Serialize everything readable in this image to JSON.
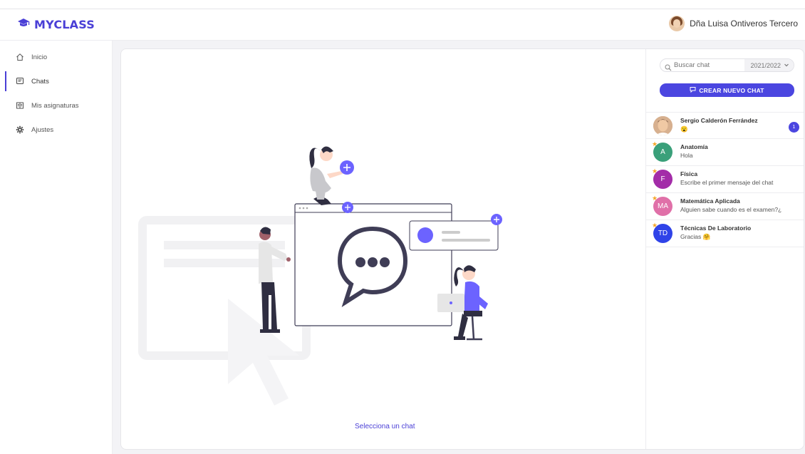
{
  "header": {
    "brand": "MYCLASS",
    "user_name": "Dña Luisa Ontiveros Tercero"
  },
  "sidebar": {
    "items": [
      {
        "label": "Inicio",
        "icon": "home-icon",
        "active": false
      },
      {
        "label": "Chats",
        "icon": "chat-icon",
        "active": true
      },
      {
        "label": "Mis asignaturas",
        "icon": "subjects-icon",
        "active": false
      },
      {
        "label": "Ajustes",
        "icon": "gear-icon",
        "active": false
      }
    ]
  },
  "main": {
    "select_chat_label": "Selecciona un chat"
  },
  "chat_panel": {
    "search_placeholder": "Buscar chat",
    "year": "2021/2022",
    "create_button": "CREAR NUEVO CHAT",
    "chats": [
      {
        "name": "Sergio Calderón Ferrández",
        "message": "😮",
        "avatar_type": "photo",
        "unread": "1",
        "starred": false
      },
      {
        "name": "Anatomía",
        "message": "Hola",
        "initials": "A",
        "color": "#3aa07a",
        "starred": true
      },
      {
        "name": "Física",
        "message": "Escribe el primer mensaje del chat",
        "initials": "F",
        "color": "#a32ca8",
        "starred": true
      },
      {
        "name": "Matemática Aplicada",
        "message": "Alguien sabe cuando es el examen?¿",
        "initials": "MA",
        "color": "#e070a8",
        "starred": true
      },
      {
        "name": "Técnicas De Laboratorio",
        "message": "Gracias 🤗",
        "initials": "TD",
        "color": "#2f43e8",
        "starred": true
      }
    ]
  },
  "colors": {
    "accent": "#4a3fd6",
    "button": "#4b46e0"
  }
}
